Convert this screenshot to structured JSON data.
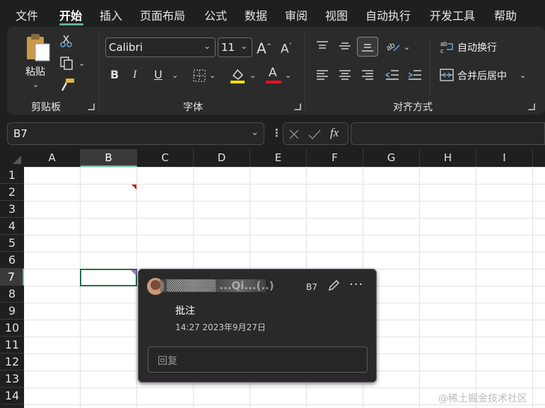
{
  "menu": {
    "items": [
      "文件",
      "开始",
      "插入",
      "页面布局",
      "公式",
      "数据",
      "审阅",
      "视图",
      "自动执行",
      "开发工具",
      "帮助"
    ],
    "active_index": 1
  },
  "ribbon": {
    "clipboard": {
      "paste_label": "粘贴",
      "group_label": "剪贴板"
    },
    "font": {
      "font_name": "Calibri",
      "font_size": "11",
      "group_label": "字体",
      "bold": "B",
      "italic": "I",
      "underline": "U",
      "font_color_glyph": "A",
      "grow_font": "A",
      "shrink_font": "A",
      "highlight_color": "#ffe000",
      "font_color": "#e81123"
    },
    "alignment": {
      "wrap_text_label": "自动换行",
      "merge_center_label": "合并后居中",
      "group_label": "对齐方式"
    }
  },
  "formula_bar": {
    "name_box": "B7",
    "fx_label": "fx",
    "value": ""
  },
  "grid": {
    "columns": [
      "A",
      "B",
      "C",
      "D",
      "E",
      "F",
      "G",
      "H",
      "I"
    ],
    "rows": [
      "1",
      "2",
      "3",
      "4",
      "5",
      "6",
      "7",
      "8",
      "9",
      "10",
      "11",
      "12",
      "13",
      "14"
    ],
    "selected_column": "B",
    "selected_row": "7",
    "active_cell": "B7"
  },
  "comment": {
    "author": "▒▒▒▒▒▒ ...Qi...(..)",
    "cell_ref": "B7",
    "text": "批注",
    "timestamp": "14:27 2023年9月27日",
    "reply_placeholder": "回复"
  },
  "watermark": "@稀土掘金技术社区",
  "colors": {
    "accent": "#6abf94",
    "comment_marker": "#b06ac0",
    "note_marker": "#d11d1d"
  }
}
